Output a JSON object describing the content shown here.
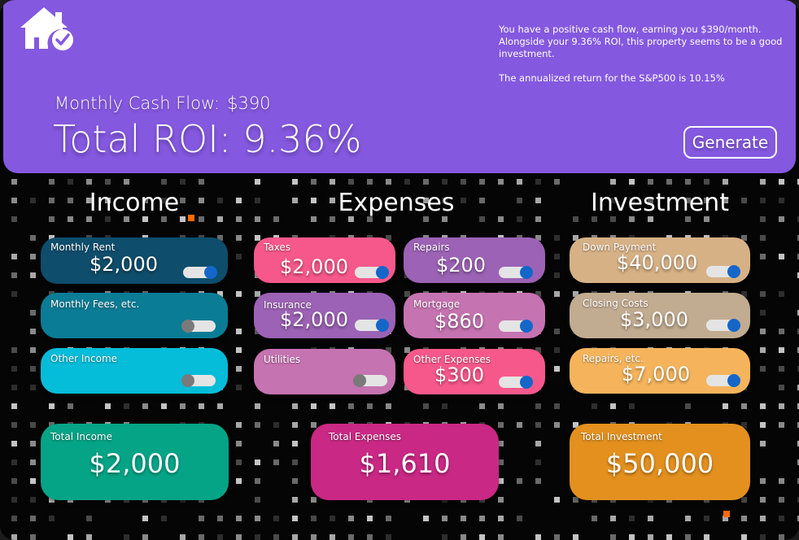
{
  "header": {
    "summary_line1": "You have a positive cash flow, earning you $390/month. Alongside your 9.36% ROI, this property seems to be a good investment.",
    "summary_line2": "The annualized return for the S&P500 is 10.15%",
    "cash_flow_label": "Monthly Cash Flow:",
    "cash_flow_value": "$390",
    "roi_label": "Total ROI:",
    "roi_value": "9.36%",
    "generate_label": "Generate",
    "logo_icon": "house-check-icon"
  },
  "sections": {
    "income_title": "Income",
    "expenses_title": "Expenses",
    "investment_title": "Investment"
  },
  "income": {
    "monthly_rent": {
      "label": "Monthly Rent",
      "value": "$2,000",
      "enabled": true
    },
    "monthly_fees": {
      "label": "Monthly Fees, etc.",
      "value": "",
      "enabled": false
    },
    "other_income": {
      "label": "Other Income",
      "value": "",
      "enabled": false
    },
    "total": {
      "label": "Total Income",
      "value": "$2,000"
    }
  },
  "expenses": {
    "taxes": {
      "label": "Taxes",
      "value": "$2,000",
      "enabled": true
    },
    "repairs": {
      "label": "Repairs",
      "value": "$200",
      "enabled": true
    },
    "insurance": {
      "label": "Insurance",
      "value": "$2,000",
      "enabled": true
    },
    "mortgage": {
      "label": "Mortgage",
      "value": "$860",
      "enabled": true
    },
    "utilities": {
      "label": "Utilities",
      "value": "",
      "enabled": false
    },
    "other_expenses": {
      "label": "Other Expenses",
      "value": "$300",
      "enabled": true
    },
    "total": {
      "label": "Total Expenses",
      "value": "$1,610"
    }
  },
  "investment": {
    "down_payment": {
      "label": "Down Payment",
      "value": "$40,000",
      "enabled": true
    },
    "closing_costs": {
      "label": "Closing Costs",
      "value": "$3,000",
      "enabled": true
    },
    "repairs": {
      "label": "Repairs, etc.",
      "value": "$7,000",
      "enabled": true
    },
    "total": {
      "label": "Total Investment",
      "value": "$50,000"
    }
  },
  "colors": {
    "header_bg": "#8458df",
    "income_rent": "#0e4d6b",
    "income_fees": "#0b7c95",
    "income_other": "#05bcd9",
    "expense_pink": "#f7588c",
    "expense_purple": "#9c62b5",
    "expense_mauve": "#c673b1",
    "invest_down": "#d7b186",
    "invest_closing": "#c2ac91",
    "invest_repairs": "#f5b45c",
    "total_income": "#05a486",
    "total_expenses": "#c92884",
    "total_investment": "#e3901e",
    "toggle_on": "#1466c9",
    "accent_square": "#ff6a00"
  }
}
